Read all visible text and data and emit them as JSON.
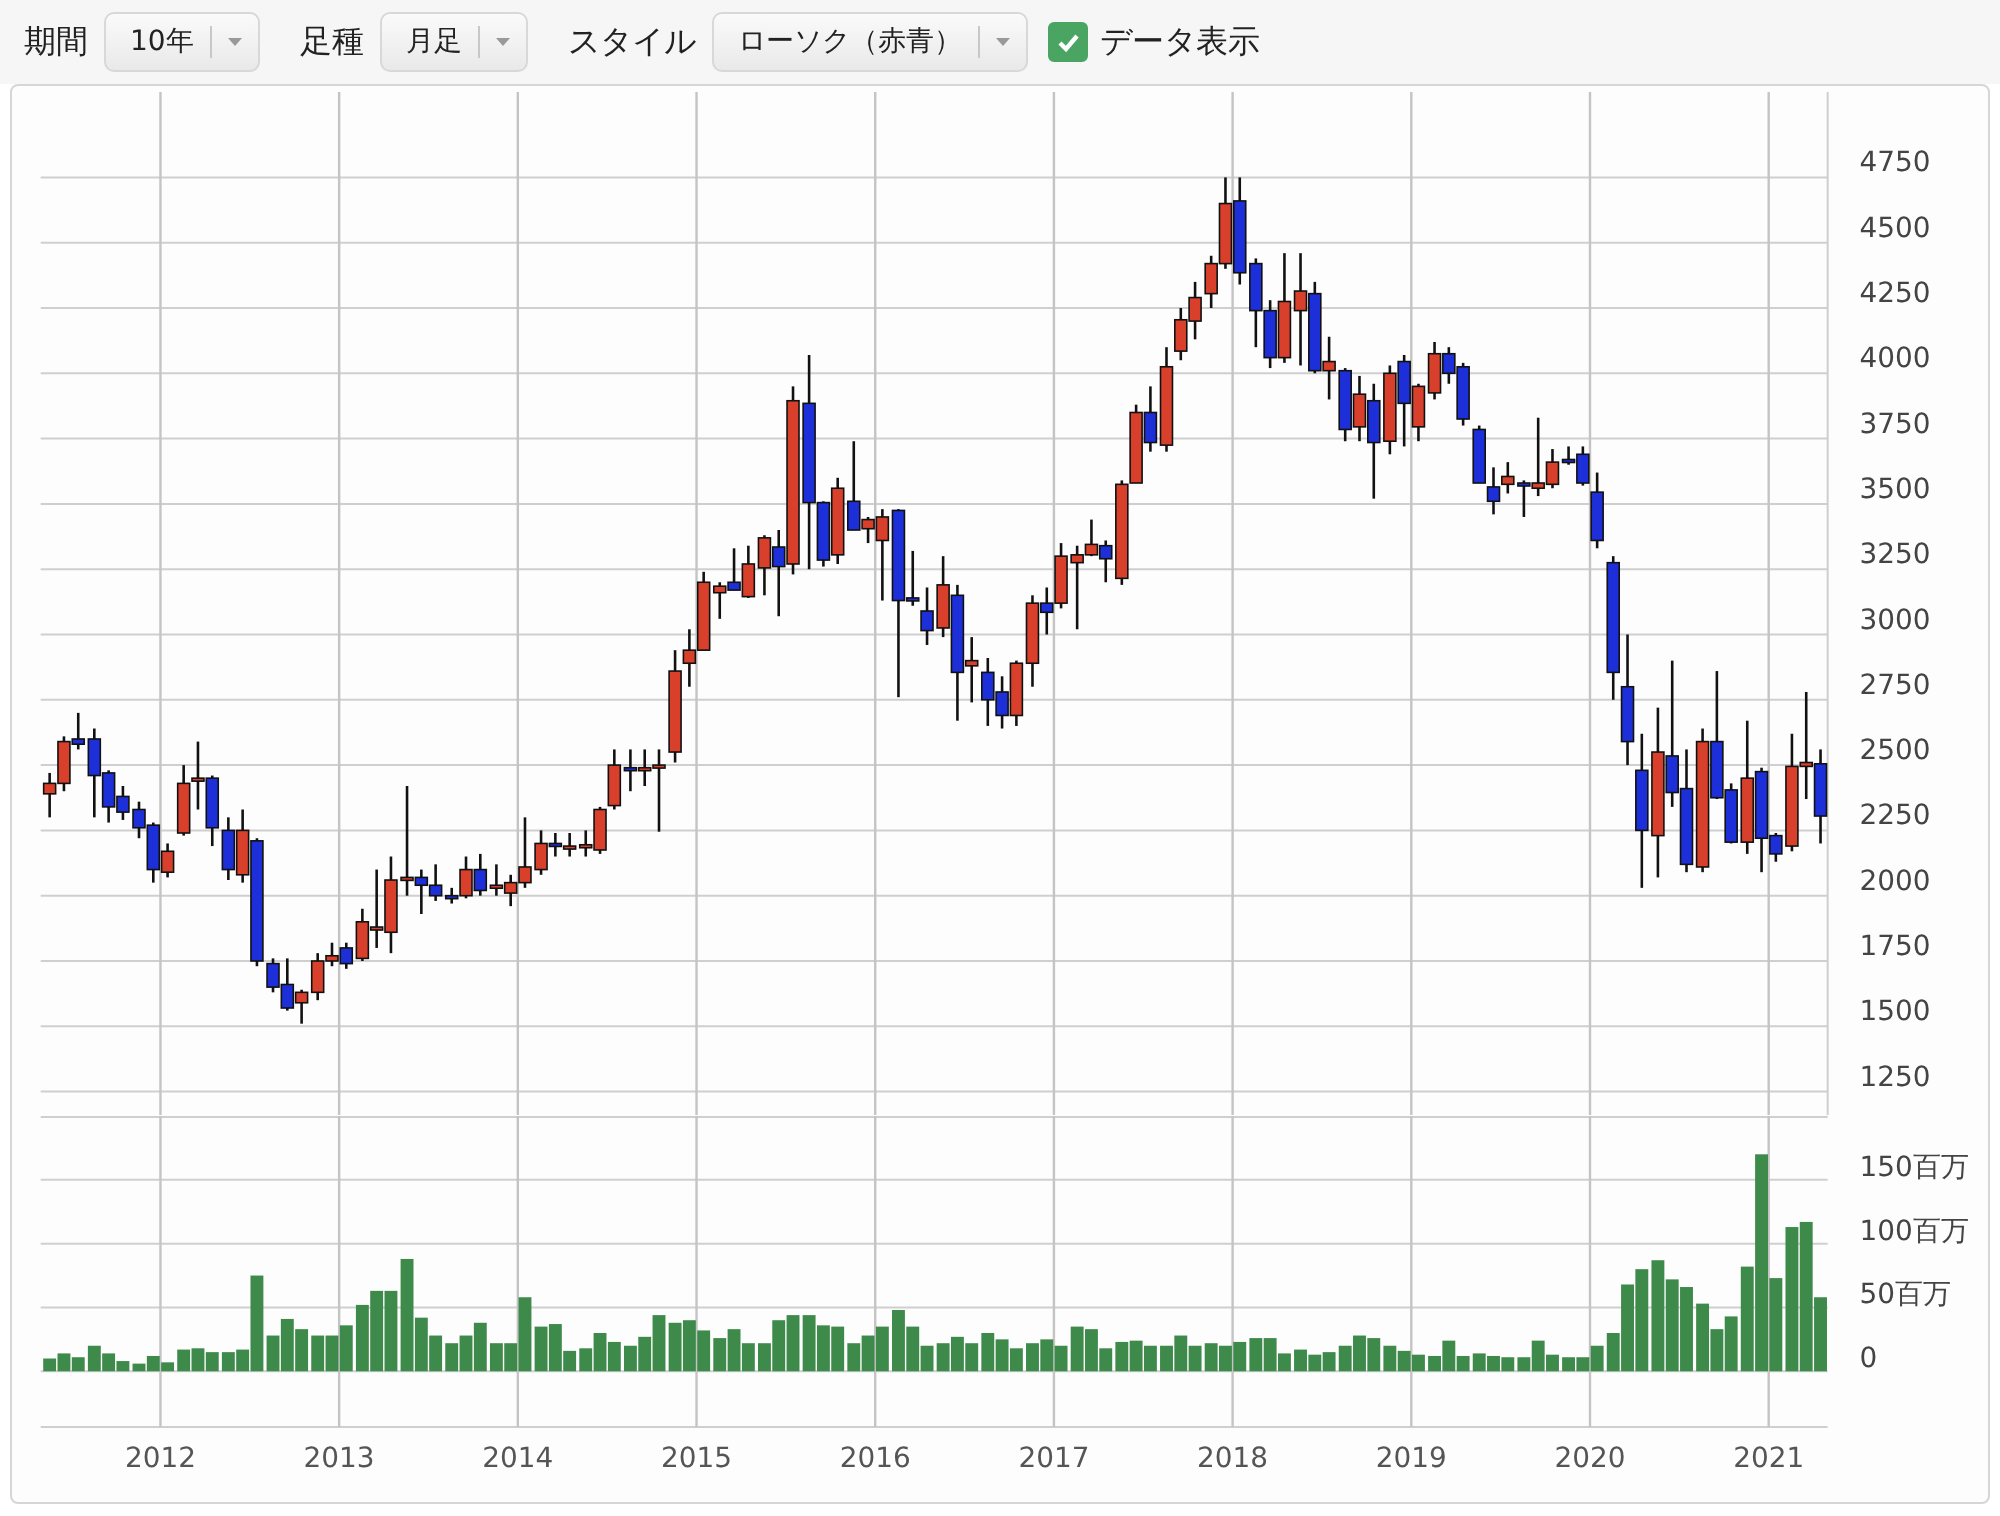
{
  "toolbar": {
    "period": {
      "label": "期間",
      "value": "10年"
    },
    "interval": {
      "label": "足種",
      "value": "月足"
    },
    "style": {
      "label": "スタイル",
      "value": "ローソク（赤青）"
    },
    "show_data": {
      "label": "データ表示",
      "checked": true
    }
  },
  "price_chart": {
    "chart_data": {
      "type": "candlestick",
      "grid": true,
      "xlim": [
        2011.33,
        2021.33
      ],
      "ylim": [
        1160,
        5100
      ],
      "yticks": [
        1250,
        1500,
        1750,
        2000,
        2250,
        2500,
        2750,
        3000,
        3250,
        3500,
        3750,
        4000,
        4250,
        4500,
        4750
      ],
      "x": [
        2011.38,
        2011.46,
        2011.54,
        2011.63,
        2011.71,
        2011.79,
        2011.88,
        2011.96,
        2012.04,
        2012.13,
        2012.21,
        2012.29,
        2012.38,
        2012.46,
        2012.54,
        2012.63,
        2012.71,
        2012.79,
        2012.88,
        2012.96,
        2013.04,
        2013.13,
        2013.21,
        2013.29,
        2013.38,
        2013.46,
        2013.54,
        2013.63,
        2013.71,
        2013.79,
        2013.88,
        2013.96,
        2014.04,
        2014.13,
        2014.21,
        2014.29,
        2014.38,
        2014.46,
        2014.54,
        2014.63,
        2014.71,
        2014.79,
        2014.88,
        2014.96,
        2015.04,
        2015.13,
        2015.21,
        2015.29,
        2015.38,
        2015.46,
        2015.54,
        2015.63,
        2015.71,
        2015.79,
        2015.88,
        2015.96,
        2016.04,
        2016.13,
        2016.21,
        2016.29,
        2016.38,
        2016.46,
        2016.54,
        2016.63,
        2016.71,
        2016.79,
        2016.88,
        2016.96,
        2017.04,
        2017.13,
        2017.21,
        2017.29,
        2017.38,
        2017.46,
        2017.54,
        2017.63,
        2017.71,
        2017.79,
        2017.88,
        2017.96,
        2018.04,
        2018.13,
        2018.21,
        2018.29,
        2018.38,
        2018.46,
        2018.54,
        2018.63,
        2018.71,
        2018.79,
        2018.88,
        2018.96,
        2019.04,
        2019.13,
        2019.21,
        2019.29,
        2019.38,
        2019.46,
        2019.54,
        2019.63,
        2019.71,
        2019.79,
        2019.88,
        2019.96,
        2020.04,
        2020.13,
        2020.21,
        2020.29,
        2020.38,
        2020.46,
        2020.54,
        2020.63,
        2020.71,
        2020.79,
        2020.88,
        2020.96,
        2021.04,
        2021.13,
        2021.21,
        2021.29
      ],
      "ohlc": [
        [
          2390,
          2470,
          2300,
          2430
        ],
        [
          2430,
          2610,
          2400,
          2590
        ],
        [
          2600,
          2700,
          2560,
          2580
        ],
        [
          2600,
          2640,
          2300,
          2460
        ],
        [
          2470,
          2480,
          2280,
          2340
        ],
        [
          2380,
          2420,
          2290,
          2320
        ],
        [
          2330,
          2360,
          2220,
          2260
        ],
        [
          2270,
          2280,
          2050,
          2100
        ],
        [
          2090,
          2200,
          2070,
          2170
        ],
        [
          2240,
          2500,
          2230,
          2430
        ],
        [
          2440,
          2590,
          2330,
          2450
        ],
        [
          2450,
          2460,
          2190,
          2260
        ],
        [
          2250,
          2300,
          2060,
          2100
        ],
        [
          2080,
          2330,
          2050,
          2250
        ],
        [
          2210,
          2220,
          1730,
          1750
        ],
        [
          1740,
          1760,
          1630,
          1650
        ],
        [
          1660,
          1760,
          1560,
          1570
        ],
        [
          1590,
          1640,
          1510,
          1630
        ],
        [
          1630,
          1780,
          1600,
          1750
        ],
        [
          1750,
          1820,
          1730,
          1770
        ],
        [
          1800,
          1820,
          1720,
          1740
        ],
        [
          1760,
          1950,
          1750,
          1900
        ],
        [
          1870,
          2100,
          1800,
          1880
        ],
        [
          1860,
          2150,
          1780,
          2060
        ],
        [
          2060,
          2420,
          2000,
          2070
        ],
        [
          2070,
          2100,
          1930,
          2040
        ],
        [
          2040,
          2120,
          1980,
          2000
        ],
        [
          2000,
          2030,
          1970,
          1990
        ],
        [
          2000,
          2150,
          1990,
          2100
        ],
        [
          2100,
          2160,
          2000,
          2020
        ],
        [
          2030,
          2120,
          2000,
          2040
        ],
        [
          2010,
          2080,
          1960,
          2050
        ],
        [
          2050,
          2300,
          2030,
          2110
        ],
        [
          2100,
          2250,
          2080,
          2200
        ],
        [
          2200,
          2240,
          2150,
          2190
        ],
        [
          2190,
          2240,
          2150,
          2190
        ],
        [
          2190,
          2250,
          2150,
          2195
        ],
        [
          2175,
          2340,
          2160,
          2330
        ],
        [
          2345,
          2560,
          2330,
          2500
        ],
        [
          2490,
          2560,
          2400,
          2480
        ],
        [
          2480,
          2560,
          2420,
          2490
        ],
        [
          2490,
          2560,
          2245,
          2500
        ],
        [
          2550,
          2940,
          2510,
          2860
        ],
        [
          2890,
          3020,
          2800,
          2940
        ],
        [
          2940,
          3240,
          2940,
          3200
        ],
        [
          3160,
          3200,
          3060,
          3185
        ],
        [
          3200,
          3330,
          3170,
          3170
        ],
        [
          3145,
          3340,
          3140,
          3270
        ],
        [
          3255,
          3380,
          3150,
          3370
        ],
        [
          3335,
          3400,
          3070,
          3260
        ],
        [
          3270,
          3950,
          3230,
          3895
        ],
        [
          3885,
          4070,
          3250,
          3505
        ],
        [
          3505,
          3510,
          3260,
          3285
        ],
        [
          3305,
          3600,
          3270,
          3560
        ],
        [
          3510,
          3740,
          3400,
          3400
        ],
        [
          3405,
          3450,
          3350,
          3440
        ],
        [
          3360,
          3480,
          3130,
          3450
        ],
        [
          3475,
          3480,
          2760,
          3130
        ],
        [
          3140,
          3320,
          3110,
          3130
        ],
        [
          3090,
          3180,
          2960,
          3015
        ],
        [
          3025,
          3300,
          2990,
          3190
        ],
        [
          3150,
          3190,
          2670,
          2855
        ],
        [
          2880,
          2990,
          2740,
          2900
        ],
        [
          2855,
          2910,
          2650,
          2750
        ],
        [
          2780,
          2840,
          2640,
          2690
        ],
        [
          2690,
          2900,
          2650,
          2890
        ],
        [
          2890,
          3150,
          2800,
          3120
        ],
        [
          3120,
          3180,
          3000,
          3085
        ],
        [
          3120,
          3350,
          3100,
          3300
        ],
        [
          3275,
          3340,
          3020,
          3305
        ],
        [
          3305,
          3440,
          3300,
          3345
        ],
        [
          3340,
          3360,
          3200,
          3290
        ],
        [
          3215,
          3590,
          3190,
          3575
        ],
        [
          3580,
          3880,
          3580,
          3850
        ],
        [
          3850,
          3950,
          3700,
          3735
        ],
        [
          3725,
          4100,
          3700,
          4025
        ],
        [
          4085,
          4250,
          4050,
          4205
        ],
        [
          4200,
          4350,
          4130,
          4290
        ],
        [
          4305,
          4450,
          4250,
          4420
        ],
        [
          4420,
          4750,
          4400,
          4650
        ],
        [
          4660,
          4750,
          4340,
          4385
        ],
        [
          4420,
          4440,
          4100,
          4240
        ],
        [
          4240,
          4280,
          4020,
          4060
        ],
        [
          4060,
          4460,
          4040,
          4275
        ],
        [
          4240,
          4460,
          4030,
          4315
        ],
        [
          4305,
          4350,
          4000,
          4010
        ],
        [
          4010,
          4140,
          3900,
          4045
        ],
        [
          4010,
          4020,
          3740,
          3785
        ],
        [
          3795,
          3990,
          3740,
          3920
        ],
        [
          3895,
          3960,
          3520,
          3735
        ],
        [
          3740,
          4030,
          3690,
          4000
        ],
        [
          4045,
          4070,
          3720,
          3885
        ],
        [
          3795,
          3960,
          3740,
          3950
        ],
        [
          3925,
          4120,
          3900,
          4075
        ],
        [
          4075,
          4100,
          3960,
          4000
        ],
        [
          4025,
          4040,
          3800,
          3825
        ],
        [
          3785,
          3800,
          3580,
          3580
        ],
        [
          3565,
          3640,
          3460,
          3510
        ],
        [
          3575,
          3660,
          3540,
          3605
        ],
        [
          3580,
          3590,
          3450,
          3575
        ],
        [
          3560,
          3830,
          3530,
          3580
        ],
        [
          3575,
          3710,
          3560,
          3660
        ],
        [
          3670,
          3720,
          3650,
          3665
        ],
        [
          3690,
          3720,
          3570,
          3580
        ],
        [
          3545,
          3620,
          3330,
          3360
        ],
        [
          3275,
          3300,
          2750,
          2855
        ],
        [
          2800,
          3000,
          2500,
          2590
        ],
        [
          2480,
          2620,
          2030,
          2250
        ],
        [
          2230,
          2720,
          2070,
          2550
        ],
        [
          2535,
          2900,
          2340,
          2395
        ],
        [
          2410,
          2560,
          2090,
          2120
        ],
        [
          2110,
          2640,
          2090,
          2590
        ],
        [
          2590,
          2860,
          2370,
          2375
        ],
        [
          2405,
          2430,
          2200,
          2205
        ],
        [
          2205,
          2670,
          2160,
          2450
        ],
        [
          2475,
          2490,
          2090,
          2220
        ],
        [
          2230,
          2240,
          2130,
          2160
        ],
        [
          2190,
          2620,
          2170,
          2495
        ],
        [
          2495,
          2780,
          2370,
          2510
        ],
        [
          2505,
          2560,
          2200,
          2305
        ]
      ]
    }
  },
  "volume_chart": {
    "chart_data": {
      "type": "bar",
      "grid": true,
      "xlim": [
        2011.33,
        2021.33
      ],
      "ylim": [
        0,
        200
      ],
      "xticks": [
        2012,
        2013,
        2014,
        2015,
        2016,
        2017,
        2018,
        2019,
        2020,
        2021
      ],
      "x": [
        2011.38,
        2011.46,
        2011.54,
        2011.63,
        2011.71,
        2011.79,
        2011.88,
        2011.96,
        2012.04,
        2012.13,
        2012.21,
        2012.29,
        2012.38,
        2012.46,
        2012.54,
        2012.63,
        2012.71,
        2012.79,
        2012.88,
        2012.96,
        2013.04,
        2013.13,
        2013.21,
        2013.29,
        2013.38,
        2013.46,
        2013.54,
        2013.63,
        2013.71,
        2013.79,
        2013.88,
        2013.96,
        2014.04,
        2014.13,
        2014.21,
        2014.29,
        2014.38,
        2014.46,
        2014.54,
        2014.63,
        2014.71,
        2014.79,
        2014.88,
        2014.96,
        2015.04,
        2015.13,
        2015.21,
        2015.29,
        2015.38,
        2015.46,
        2015.54,
        2015.63,
        2015.71,
        2015.79,
        2015.88,
        2015.96,
        2016.04,
        2016.13,
        2016.21,
        2016.29,
        2016.38,
        2016.46,
        2016.54,
        2016.63,
        2016.71,
        2016.79,
        2016.88,
        2016.96,
        2017.04,
        2017.13,
        2017.21,
        2017.29,
        2017.38,
        2017.46,
        2017.54,
        2017.63,
        2017.71,
        2017.79,
        2017.88,
        2017.96,
        2018.04,
        2018.13,
        2018.21,
        2018.29,
        2018.38,
        2018.46,
        2018.54,
        2018.63,
        2018.71,
        2018.79,
        2018.88,
        2018.96,
        2019.04,
        2019.13,
        2019.21,
        2019.29,
        2019.38,
        2019.46,
        2019.54,
        2019.63,
        2019.71,
        2019.79,
        2019.88,
        2019.96,
        2020.04,
        2020.13,
        2020.21,
        2020.29,
        2020.38,
        2020.46,
        2020.54,
        2020.63,
        2020.71,
        2020.79,
        2020.88,
        2020.96,
        2021.04,
        2021.13,
        2021.21,
        2021.29
      ],
      "yticks": [
        {
          "value": 0,
          "label": "0"
        },
        {
          "value": 50,
          "label": "50百万"
        },
        {
          "value": 100,
          "label": "100百万"
        },
        {
          "value": 150,
          "label": "150百万"
        }
      ],
      "series": [
        {
          "color": "#3d8a4b",
          "values": [
            10,
            14,
            11,
            20,
            14,
            8,
            6,
            12,
            7,
            17,
            18,
            15,
            15,
            17,
            75,
            28,
            41,
            33,
            28,
            28,
            36,
            52,
            63,
            63,
            88,
            42,
            28,
            22,
            28,
            38,
            22,
            22,
            58,
            35,
            37,
            16,
            18,
            30,
            23,
            20,
            27,
            44,
            38,
            40,
            32,
            26,
            33,
            22,
            22,
            40,
            44,
            44,
            36,
            35,
            22,
            28,
            35,
            48,
            35,
            20,
            22,
            27,
            22,
            30,
            25,
            18,
            22,
            25,
            20,
            35,
            33,
            18,
            23,
            24,
            20,
            20,
            28,
            20,
            22,
            20,
            23,
            26,
            26,
            14,
            17,
            13,
            15,
            20,
            28,
            26,
            20,
            16,
            13,
            12,
            24,
            12,
            14,
            12,
            11,
            11,
            24,
            13,
            11,
            11,
            20,
            30,
            68,
            80,
            87,
            72,
            66,
            53,
            33,
            43,
            82,
            170,
            73,
            113,
            117,
            58
          ]
        }
      ]
    }
  }
}
